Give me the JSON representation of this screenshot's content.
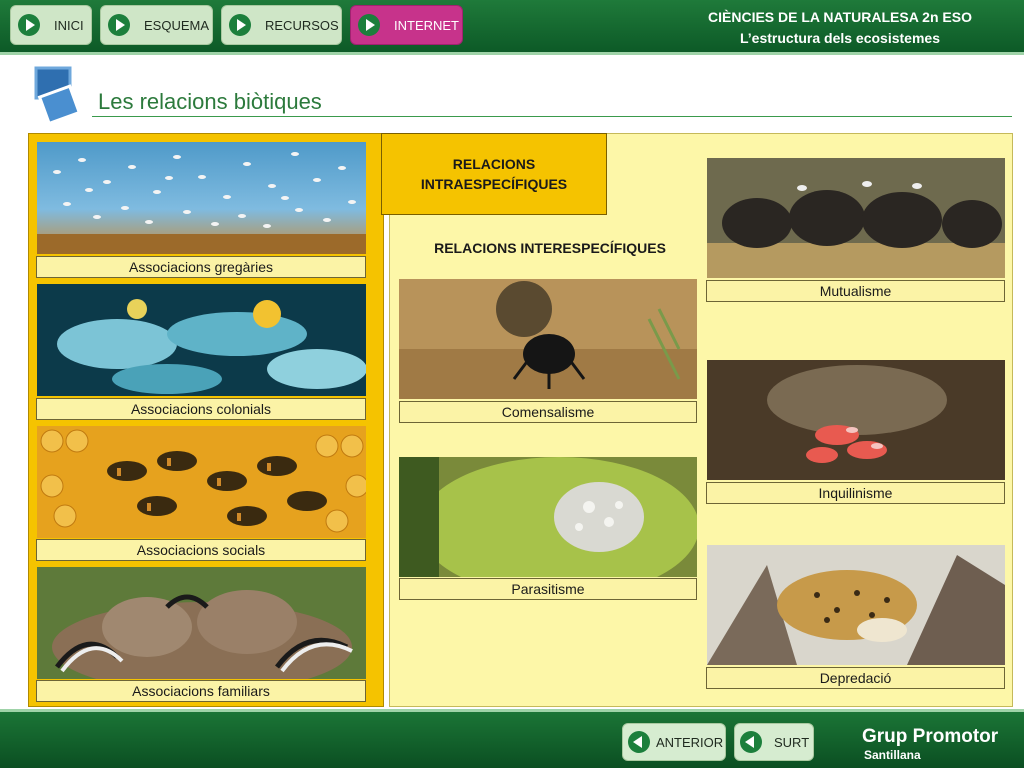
{
  "nav": {
    "inici": "INICI",
    "esquema": "ESQUEMA",
    "recursos": "RECURSOS",
    "internet": "INTERNET"
  },
  "course": {
    "title": "CIÈNCIES DE LA NATURALESA 2n ESO",
    "subtitle": "L’estructura dels ecosistemes"
  },
  "page": {
    "title": "Les relacions biòtiques"
  },
  "intra": {
    "heading": "RELACIONS INTRAESPECÍFIQUES",
    "items": [
      "Associacions gregàries",
      "Associacions colonials",
      "Associacions socials",
      "Associacions familiars"
    ]
  },
  "inter": {
    "heading": "RELACIONS INTERESPECÍFIQUES",
    "items": [
      "Comensalisme",
      "Parasitisme",
      "Mutualisme",
      "Inquilinisme",
      "Depredació"
    ]
  },
  "footer": {
    "anterior": "ANTERIOR",
    "surt": "SURT",
    "brand": "Grup Promotor",
    "brand_sub": "Santillana"
  },
  "colors": {
    "green_bar": "#1f7a3a",
    "yellow_panel": "#f5c300",
    "pale_panel": "#fdf7a8",
    "internet_button": "#c7338b"
  }
}
